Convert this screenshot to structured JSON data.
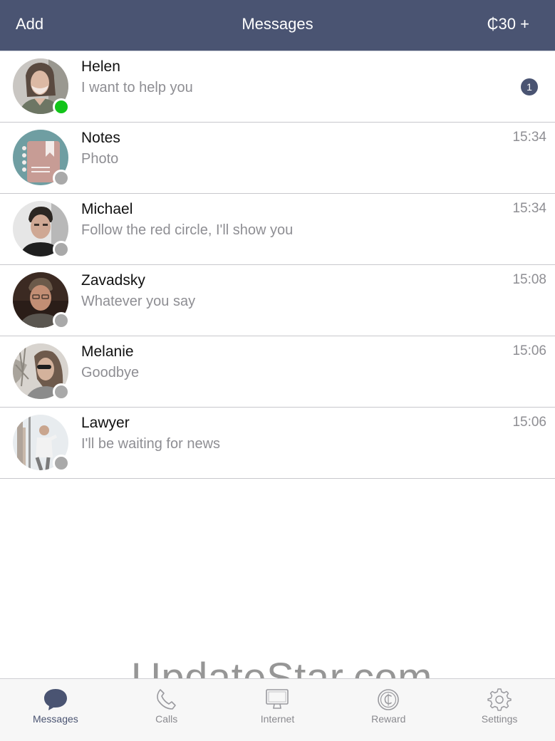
{
  "header": {
    "add_label": "Add",
    "title": "Messages",
    "credits_label": "₵30 +"
  },
  "colors": {
    "header_bg": "#4a5472",
    "accent": "#4a5472",
    "online": "#12c41a",
    "offline": "#a9a9a9"
  },
  "conversations": [
    {
      "name": "Helen",
      "preview": "I want to help you",
      "time": "",
      "unread": "1",
      "online": true,
      "avatar_icon": "helen-photo"
    },
    {
      "name": "Notes",
      "preview": "Photo",
      "time": "15:34",
      "unread": "",
      "online": false,
      "avatar_icon": "notebook-icon"
    },
    {
      "name": "Michael",
      "preview": "Follow the red circle, I'll show you",
      "time": "15:34",
      "unread": "",
      "online": false,
      "avatar_icon": "michael-photo"
    },
    {
      "name": "Zavadsky",
      "preview": "Whatever you say",
      "time": "15:08",
      "unread": "",
      "online": false,
      "avatar_icon": "zavadsky-photo"
    },
    {
      "name": "Melanie",
      "preview": "Goodbye",
      "time": "15:06",
      "unread": "",
      "online": false,
      "avatar_icon": "melanie-photo"
    },
    {
      "name": "Lawyer",
      "preview": "I'll be waiting for news",
      "time": "15:06",
      "unread": "",
      "online": false,
      "avatar_icon": "lawyer-photo"
    }
  ],
  "watermark": "UpdateStar.com",
  "tabs": [
    {
      "label": "Messages",
      "icon": "speech-bubble-icon",
      "active": true
    },
    {
      "label": "Calls",
      "icon": "phone-icon",
      "active": false
    },
    {
      "label": "Internet",
      "icon": "monitor-icon",
      "active": false
    },
    {
      "label": "Reward",
      "icon": "coin-icon",
      "active": false
    },
    {
      "label": "Settings",
      "icon": "gear-icon",
      "active": false
    }
  ]
}
